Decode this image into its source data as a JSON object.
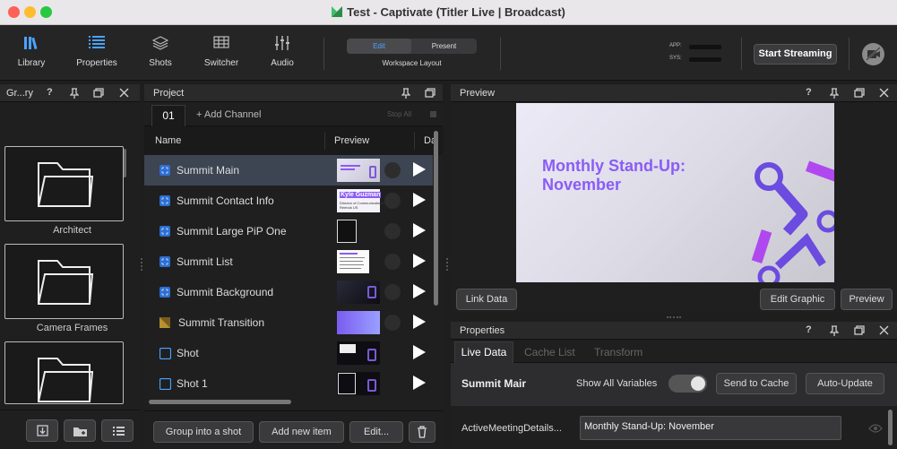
{
  "window": {
    "title": "Test - Captivate (Titler Live | Broadcast)"
  },
  "toolbar": {
    "items": [
      {
        "label": "Library",
        "icon": "library-icon",
        "active": true
      },
      {
        "label": "Properties",
        "icon": "properties-icon",
        "active": true
      },
      {
        "label": "Shots",
        "icon": "shots-icon",
        "active": false
      },
      {
        "label": "Switcher",
        "icon": "switcher-icon",
        "active": false
      },
      {
        "label": "Audio",
        "icon": "audio-icon",
        "active": false
      }
    ],
    "segments": {
      "edit": "Edit",
      "present": "Present",
      "caption": "Workspace Layout"
    },
    "meters": {
      "app": "APP:",
      "sys": "SYS:"
    },
    "start_streaming": "Start Streaming"
  },
  "gallery": {
    "title": "Gr...ry",
    "help": "?",
    "folders": [
      "Architect",
      "Camera Frames",
      ""
    ]
  },
  "project": {
    "title": "Project",
    "channel_tab": "01",
    "add_channel": "+ Add Channel",
    "stop_all": "Stop All",
    "columns": {
      "name": "Name",
      "preview": "Preview",
      "extra": "Da"
    },
    "rows": [
      {
        "name": "Summit Main",
        "type": "graphic",
        "thumb": "main",
        "selected": true
      },
      {
        "name": "Summit Contact Info",
        "type": "graphic",
        "thumb": "contact"
      },
      {
        "name": "Summit Large PiP One",
        "type": "graphic",
        "thumb": "pip"
      },
      {
        "name": "Summit List",
        "type": "graphic",
        "thumb": "list"
      },
      {
        "name": "Summit Background",
        "type": "graphic",
        "thumb": "bg"
      },
      {
        "name": "Summit Transition",
        "type": "transition",
        "thumb": "transition"
      },
      {
        "name": "Shot",
        "type": "shot",
        "thumb": "shot"
      },
      {
        "name": "Shot 1",
        "type": "shot",
        "thumb": "shot1"
      }
    ],
    "thumb_text": {
      "contact_name": "Kyle Guzman",
      "contact_title": "Director of Communications",
      "contact_sub": "Reebok US"
    },
    "buttons": {
      "group": "Group into a shot",
      "add": "Add new item",
      "edit": "Edit..."
    }
  },
  "preview": {
    "title": "Preview",
    "help": "?",
    "graphic_title": "Monthly Stand-Up: November",
    "buttons": {
      "link_data": "Link Data",
      "edit_graphic": "Edit Graphic",
      "preview": "Preview"
    }
  },
  "properties": {
    "title": "Properties",
    "help": "?",
    "tabs": [
      "Live Data",
      "Cache List",
      "Transform"
    ],
    "item_name": "Summit Mair",
    "show_all_variables": "Show All Variables",
    "send_to_cache": "Send to Cache",
    "auto_update": "Auto-Update",
    "field_label": "ActiveMeetingDetails...",
    "field_value": "Monthly Stand-Up: November"
  },
  "colors": {
    "accent": "#4aa3ff",
    "purple": "#8a5cf6",
    "selected_row": "#3d4452"
  }
}
